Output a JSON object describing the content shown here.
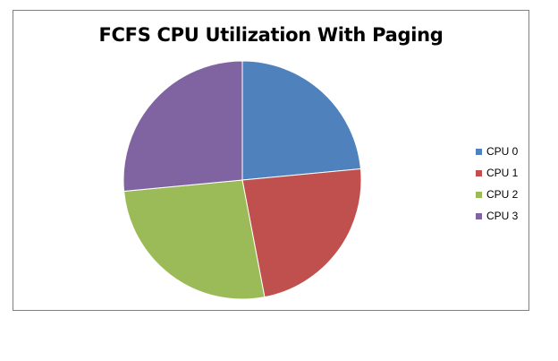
{
  "chart_data": {
    "type": "pie",
    "title": "FCFS CPU Utilization With Paging",
    "categories": [
      "CPU 0",
      "CPU 1",
      "CPU 2",
      "CPU 3"
    ],
    "values": [
      23.5,
      23.5,
      26.5,
      26.5
    ],
    "colors": [
      "#4f81bd",
      "#c0504d",
      "#9bbb59",
      "#8064a2"
    ],
    "start_angle_deg": 0,
    "direction": "clockwise",
    "legend_position": "right"
  }
}
